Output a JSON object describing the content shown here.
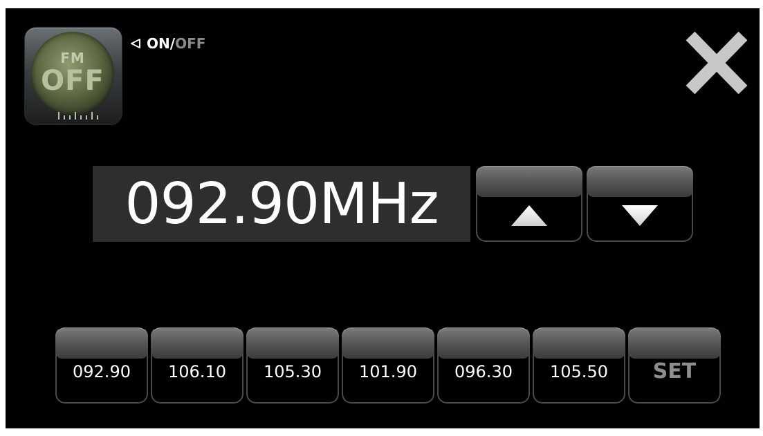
{
  "power_button": {
    "band": "FM",
    "state": "OFF"
  },
  "power_toggle": {
    "on_label": "ON",
    "separator": "/",
    "off_label": "OFF"
  },
  "frequency": {
    "value": "092.90MHz"
  },
  "tune": {
    "up_icon": "triangle-up-icon",
    "down_icon": "triangle-down-icon"
  },
  "presets": [
    {
      "label": "092.90"
    },
    {
      "label": "106.10"
    },
    {
      "label": "105.30"
    },
    {
      "label": "101.90"
    },
    {
      "label": "096.30"
    },
    {
      "label": "105.50"
    }
  ],
  "set_label": "SET",
  "colors": {
    "background": "#000000",
    "display_bg": "#2e2e2e",
    "off_text": "#8a8a8a",
    "close_icon": "#c8c8c8"
  }
}
